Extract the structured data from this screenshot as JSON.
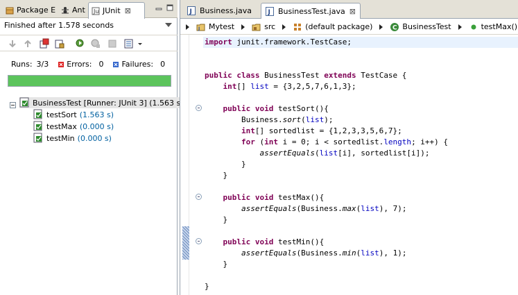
{
  "left": {
    "tabs": [
      {
        "label": "Package E"
      },
      {
        "label": "Ant"
      },
      {
        "label": "JUnit",
        "close": "⊠"
      }
    ],
    "status": "Finished after 1.578 seconds",
    "counters": {
      "runs_label": "Runs:",
      "runs_value": "3/3",
      "errors_label": "Errors:",
      "errors_value": "0",
      "failures_label": "Failures:",
      "failures_value": "0"
    },
    "progress": {
      "fraction": 1.0,
      "color": "#5cc45c"
    },
    "tree": [
      {
        "label": "BusinessTest [Runner: JUnit 3] (1.563 s)"
      },
      {
        "label": "testSort",
        "time": "(1.563 s)"
      },
      {
        "label": "testMax",
        "time": "(0.000 s)"
      },
      {
        "label": "testMin",
        "time": "(0.000 s)"
      }
    ]
  },
  "editor": {
    "tabs": [
      {
        "label": "Business.java"
      },
      {
        "label": "BusinessTest.java",
        "close": "⊠"
      }
    ],
    "breadcrumb": [
      {
        "label": "Mytest"
      },
      {
        "label": "src"
      },
      {
        "label": "(default package)"
      },
      {
        "label": "BusinessTest"
      },
      {
        "label": "testMax() : void"
      }
    ],
    "code": [
      "import junit.framework.TestCase;",
      "",
      "",
      "public class BusinessTest extends TestCase {",
      "    int[] list = {3,2,5,7,6,1,3};",
      "",
      "    public void testSort(){",
      "        Business.sort(list);",
      "        int[] sortedlist = {1,2,3,3,5,6,7};",
      "        for (int i = 0; i < sortedlist.length; i++) {",
      "            assertEquals(list[i], sortedlist[i]);",
      "        }",
      "    }",
      "",
      "    public void testMax(){",
      "        assertEquals(Business.max(list), 7);",
      "    }",
      "",
      "    public void testMin(){",
      "        assertEquals(Business.min(list), 1);",
      "    }",
      "",
      "}"
    ],
    "colors": {
      "keyword": "#7f0055",
      "field": "#0000c0",
      "current_line": "#e8f2fe"
    }
  },
  "icons": {
    "package": "package-explorer-icon",
    "ant": "ant-icon",
    "junit": "junit-icon",
    "java_file": "java-file-icon",
    "project": "project-icon",
    "source_folder": "source-folder-icon",
    "package_folder": "package-icon",
    "class": "class-icon",
    "method": "method-icon",
    "test_ok": "test-passed-icon"
  }
}
